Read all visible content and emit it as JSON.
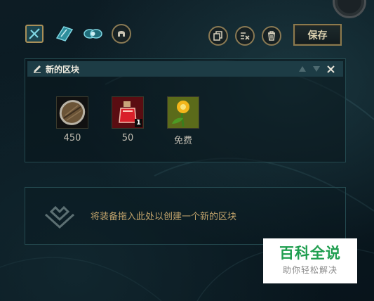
{
  "toolbar": {
    "mode_icons": [
      "summoners-rift-icon",
      "twisted-treeline-icon",
      "howling-abyss-icon",
      "helmet-icon"
    ],
    "copy_icon": "copy-icon",
    "clear_icon": "clear-list-icon",
    "delete_icon": "trash-icon",
    "save_label": "保存"
  },
  "block": {
    "title": "新的区块",
    "items": [
      {
        "name": "wooden-shield",
        "cost": "450",
        "count": ""
      },
      {
        "name": "health-potion",
        "cost": "50",
        "count": "1"
      },
      {
        "name": "golden-flower",
        "cost": "免费",
        "count": ""
      }
    ]
  },
  "drop_zone": {
    "text": "将装备拖入此处以创建一个新的区块"
  },
  "watermark": {
    "title": "百科全说",
    "subtitle": "助你轻松解决"
  },
  "colors": {
    "gold_border": "#8a7a54",
    "header_bg": "#1d3c45",
    "panel_border": "#24494f",
    "drop_text": "#c1a36b",
    "watermark_green": "#1f9e4f"
  }
}
